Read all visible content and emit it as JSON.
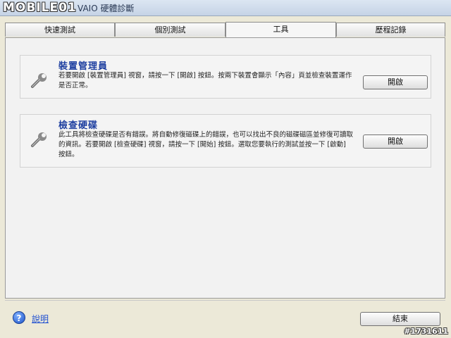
{
  "window": {
    "watermark": "MOBILE01",
    "title": "VAIO 硬體診斷"
  },
  "tabs": [
    {
      "label": "快速測試",
      "active": false
    },
    {
      "label": "個別測試",
      "active": false
    },
    {
      "label": "工具",
      "active": true
    },
    {
      "label": "歷程記錄",
      "active": false
    }
  ],
  "tools": [
    {
      "icon": "wrench-icon",
      "title": "裝置管理員",
      "description": "若要開啟 [裝置管理員] 視窗，請按一下 [開啟] 按鈕。按兩下裝置會顯示「內容」頁並檢查裝置運作是否正常。",
      "button_label": "開啟"
    },
    {
      "icon": "wrench-icon",
      "title": "檢查硬碟",
      "description": "此工具將檢查硬碟是否有錯誤。將自動修復磁碟上的錯誤，也可以找出不良的磁碟磁區並修復可讀取的資訊。若要開啟 [檢查硬碟] 視窗，請按一下 [開始] 按鈕。選取您要執行的測試並按一下 [啟動] 按鈕。",
      "button_label": "開啟"
    }
  ],
  "footer": {
    "help_icon": "help-icon",
    "help_label": "說明",
    "close_label": "結束"
  },
  "badge": "#1731611"
}
